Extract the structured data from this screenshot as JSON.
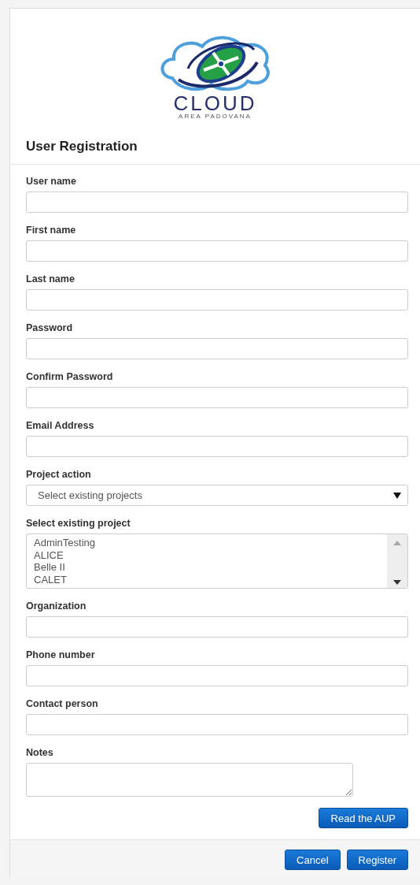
{
  "logo": {
    "name": "CLOUD",
    "subtitle": "AREA PADOVANA"
  },
  "title": "User Registration",
  "fields": [
    {
      "kind": "text",
      "label": "User name"
    },
    {
      "kind": "text",
      "label": "First name"
    },
    {
      "kind": "text",
      "label": "Last name"
    },
    {
      "kind": "text",
      "label": "Password"
    },
    {
      "kind": "text",
      "label": "Confirm Password"
    },
    {
      "kind": "text",
      "label": "Email Address"
    },
    {
      "kind": "select",
      "label": "Project action",
      "value": "Select existing projects"
    },
    {
      "kind": "listbox",
      "label": "Select existing project",
      "options": [
        "AdminTesting",
        "ALICE",
        "Belle II",
        "CALET"
      ]
    },
    {
      "kind": "text",
      "label": "Organization"
    },
    {
      "kind": "text",
      "label": "Phone number"
    },
    {
      "kind": "text",
      "label": "Contact person"
    },
    {
      "kind": "textarea",
      "label": "Notes"
    }
  ],
  "aup_button": "Read the AUP",
  "footer_buttons": [
    "Cancel",
    "Register"
  ]
}
